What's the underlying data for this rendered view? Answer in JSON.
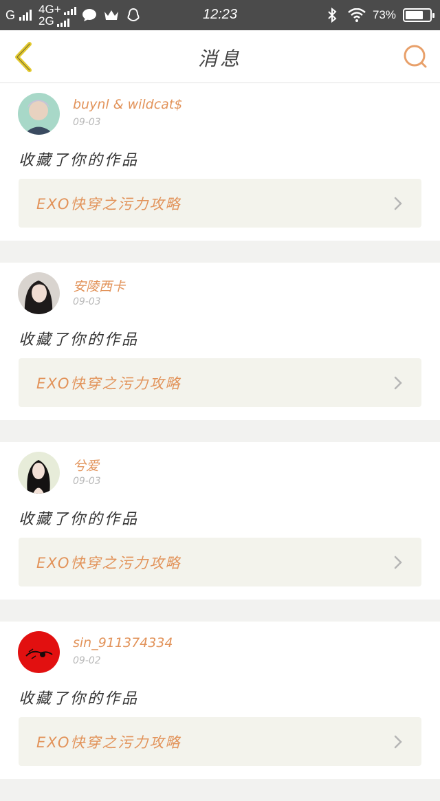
{
  "status_bar": {
    "carrier": "G",
    "network_top": "4G+",
    "network_bottom": "2G",
    "time": "12:23",
    "battery_percent_text": "73%",
    "battery_level": 0.73,
    "icons": [
      "signal-bars-icon",
      "chat-bubble-icon",
      "crown-icon",
      "qq-penguin-icon",
      "bluetooth-icon",
      "wifi-icon",
      "battery-icon"
    ]
  },
  "nav": {
    "title": "消息",
    "back_icon": "chevron-left-icon",
    "search_icon": "search-icon"
  },
  "colors": {
    "accent": "#e2935a",
    "back_arrow": "#e3c92e",
    "link_bg": "#f3f3ec",
    "status_bar": "#4b4b4b"
  },
  "messages": [
    {
      "username": "buynl & wildcat$",
      "date": "09-03",
      "action": "收藏了你的作品",
      "work_title": "EXO快穿之污力攻略",
      "avatar_icon": "avatar-photo"
    },
    {
      "username": "安陵西卡",
      "date": "09-03",
      "action": "收藏了你的作品",
      "work_title": "EXO快穿之污力攻略",
      "avatar_icon": "avatar-photo"
    },
    {
      "username": "兮爱",
      "date": "09-03",
      "action": "收藏了你的作品",
      "work_title": "EXO快穿之污力攻略",
      "avatar_icon": "avatar-photo"
    },
    {
      "username": "sin_911374334",
      "date": "09-02",
      "action": "收藏了你的作品",
      "work_title": "EXO快穿之污力攻略",
      "avatar_icon": "avatar-photo"
    }
  ]
}
